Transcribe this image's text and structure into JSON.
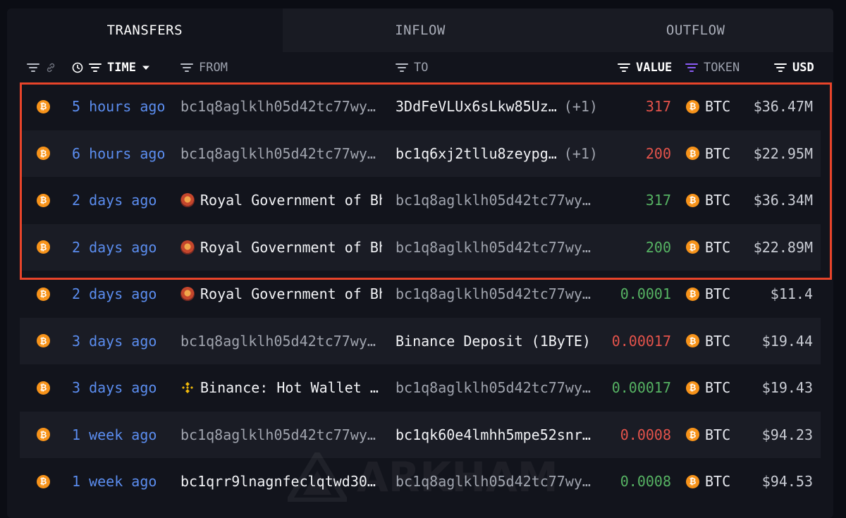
{
  "tabs": [
    {
      "label": "TRANSFERS",
      "active": true
    },
    {
      "label": "INFLOW",
      "active": false
    },
    {
      "label": "OUTFLOW",
      "active": false
    }
  ],
  "columns": {
    "time": "TIME",
    "from": "FROM",
    "to": "TO",
    "value": "VALUE",
    "token": "TOKEN",
    "usd": "USD"
  },
  "rows": [
    {
      "time": "5 hours ago",
      "from": "bc1q8aglklh05d42tc77wy…",
      "from_type": "address",
      "to": "3DdFeVLUx6sLkw85Uz…",
      "to_type": "entity",
      "to_suffix": "(+1)",
      "value": "317",
      "value_color": "red",
      "token": "BTC",
      "usd": "$36.47M"
    },
    {
      "time": "6 hours ago",
      "from": "bc1q8aglklh05d42tc77wy…",
      "from_type": "address",
      "to": "bc1q6xj2tllu8zeypg…",
      "to_type": "entity",
      "to_suffix": "(+1)",
      "value": "200",
      "value_color": "red",
      "token": "BTC",
      "usd": "$22.95M"
    },
    {
      "time": "2 days ago",
      "from": "Royal Government of Bh",
      "from_type": "royal",
      "to": "bc1q8aglklh05d42tc77wy…",
      "to_type": "address",
      "to_suffix": "",
      "value": "317",
      "value_color": "green",
      "token": "BTC",
      "usd": "$36.34M"
    },
    {
      "time": "2 days ago",
      "from": "Royal Government of Bh",
      "from_type": "royal",
      "to": "bc1q8aglklh05d42tc77wy…",
      "to_type": "address",
      "to_suffix": "",
      "value": "200",
      "value_color": "green",
      "token": "BTC",
      "usd": "$22.89M"
    },
    {
      "time": "2 days ago",
      "from": "Royal Government of Bh",
      "from_type": "royal",
      "to": "bc1q8aglklh05d42tc77wy…",
      "to_type": "address",
      "to_suffix": "",
      "value": "0.0001",
      "value_color": "green",
      "token": "BTC",
      "usd": "$11.4"
    },
    {
      "time": "3 days ago",
      "from": "bc1q8aglklh05d42tc77wy…",
      "from_type": "address",
      "to": "Binance Deposit (1ByTE)",
      "to_type": "entity",
      "to_suffix": "",
      "value": "0.00017",
      "value_color": "red",
      "token": "BTC",
      "usd": "$19.44"
    },
    {
      "time": "3 days ago",
      "from": "Binance: Hot Wallet …",
      "from_type": "binance",
      "to": "bc1q8aglklh05d42tc77wy…",
      "to_type": "address",
      "to_suffix": "",
      "value": "0.00017",
      "value_color": "green",
      "token": "BTC",
      "usd": "$19.43"
    },
    {
      "time": "1 week ago",
      "from": "bc1q8aglklh05d42tc77wy…",
      "from_type": "address",
      "to": "bc1qk60e4lmhh5mpe52snr…",
      "to_type": "entity",
      "to_suffix": "",
      "value": "0.0008",
      "value_color": "red",
      "token": "BTC",
      "usd": "$94.23"
    },
    {
      "time": "1 week ago",
      "from": "bc1qrr9lnagnfeclqtwd30…",
      "from_type": "entity",
      "to": "bc1q8aglklh05d42tc77wy…",
      "to_type": "address",
      "to_suffix": "",
      "value": "0.0008",
      "value_color": "green",
      "token": "BTC",
      "usd": "$94.53"
    }
  ],
  "watermark": "ARKHAM",
  "colors": {
    "highlight": "#e8442a",
    "time": "#5b8def",
    "red": "#e5534b",
    "green": "#56b363",
    "btc": "#f7931a",
    "token_filter": "#8b5cf6"
  },
  "icons": {
    "filter": "filter-icon",
    "link": "link-icon",
    "clock": "clock-icon",
    "sort": "caret-down-icon",
    "coin": "bitcoin-icon",
    "royal": "royal-government-icon",
    "binance": "binance-icon"
  }
}
